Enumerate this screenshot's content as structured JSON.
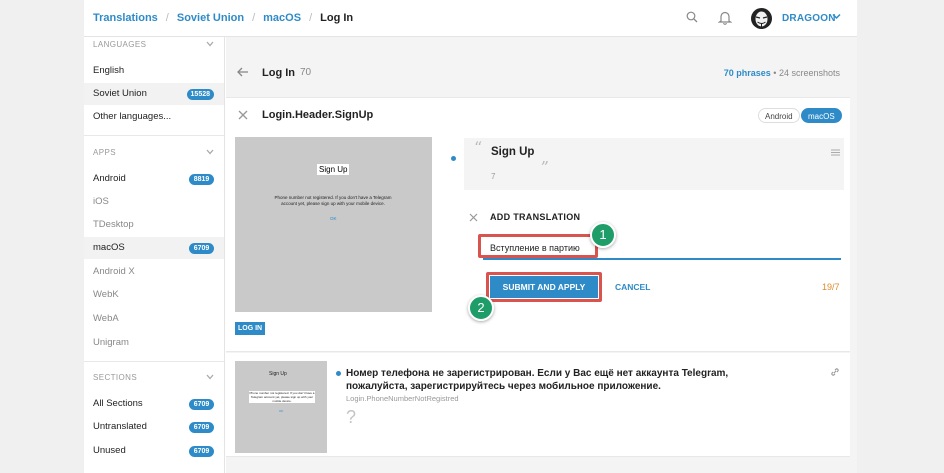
{
  "breadcrumb": [
    "Translations",
    "Soviet Union",
    "macOS",
    "Log In"
  ],
  "user": {
    "name": "DRAGOON"
  },
  "sidebar": {
    "languages_header": "LANGUAGES",
    "languages": [
      {
        "label": "English",
        "badge": ""
      },
      {
        "label": "Soviet Union",
        "badge": "15528"
      },
      {
        "label": "Other languages...",
        "badge": ""
      }
    ],
    "apps_header": "APPS",
    "apps": [
      {
        "label": "Android",
        "badge": "8819"
      },
      {
        "label": "iOS",
        "badge": ""
      },
      {
        "label": "TDesktop",
        "badge": ""
      },
      {
        "label": "macOS",
        "badge": "6709"
      },
      {
        "label": "Android X",
        "badge": ""
      },
      {
        "label": "WebK",
        "badge": ""
      },
      {
        "label": "WebA",
        "badge": ""
      },
      {
        "label": "Unigram",
        "badge": ""
      }
    ],
    "sections_header": "SECTIONS",
    "sections": [
      {
        "label": "All Sections",
        "badge": "6709"
      },
      {
        "label": "Untranslated",
        "badge": "6709"
      },
      {
        "label": "Unused",
        "badge": "6709"
      }
    ]
  },
  "phrase_header": {
    "title": "Log In",
    "count": "70",
    "phrases": "70 phrases",
    "separator": "•",
    "screenshots": "24 screenshots"
  },
  "card": {
    "key": "Login.Header.SignUp",
    "tags": [
      "Android",
      "macOS"
    ],
    "preview": {
      "title": "Sign Up",
      "text": "Phone number not registered. If you don't have a Telegram account yet, please sign up with your mobile device.",
      "ok": "OK"
    },
    "screen_button": "LOG IN",
    "source": {
      "text": "Sign Up",
      "length": "7",
      "open_quote": "“",
      "close_quote": "„"
    },
    "add_label": "ADD TRANSLATION",
    "input_value": "Вступление в партию",
    "submit": "SUBMIT AND APPLY",
    "cancel": "CANCEL",
    "char_count": "19/7"
  },
  "steps": [
    "1",
    "2"
  ],
  "card2": {
    "preview": {
      "title": "Sign Up",
      "text": "Phone number not registered. If you don't have a Telegram account yet, please sign up with your mobile device.",
      "ok": "OK"
    },
    "text": "Номер телефона не зарегистрирован. Если у Вас ещё нет аккаунта Telegram, пожалуйста, зарегистрируйтесь через мобильное приложение.",
    "key": "Login.PhoneNumberNotRegistred",
    "placeholder": "?"
  },
  "colors": {
    "accent": "#2e8bc7",
    "highlight": "#d9534f",
    "step": "#1e9d68",
    "count_over": "#e08a2b"
  }
}
